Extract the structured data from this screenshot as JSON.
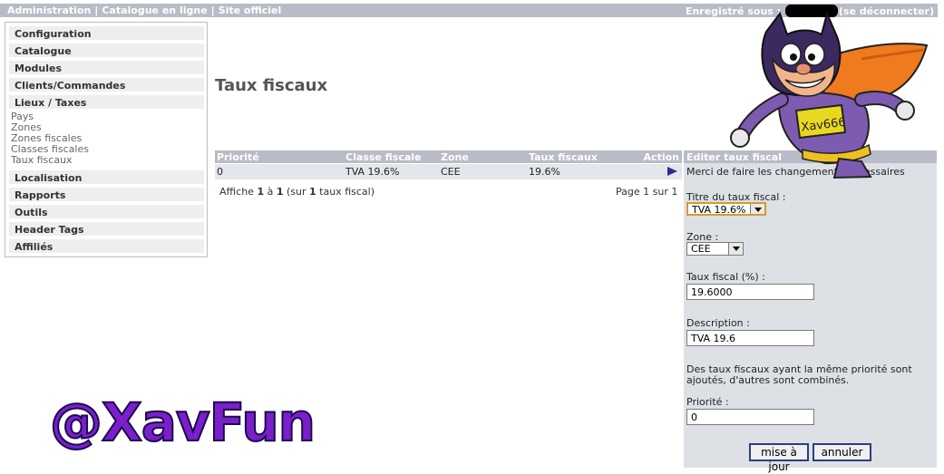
{
  "topbar": {
    "links": [
      "Administration",
      "Catalogue en ligne",
      "Site officiel"
    ],
    "separator": "|",
    "registered_prefix": "Enregistré sous :",
    "logout": "(se déconnecter)"
  },
  "nav": {
    "items_top": [
      "Configuration",
      "Catalogue",
      "Modules",
      "Clients/Commandes",
      "Lieux / Taxes"
    ],
    "subitems": [
      "Pays",
      "Zones",
      "Zones fiscales",
      "Classes fiscales",
      "Taux fiscaux"
    ],
    "items_bottom": [
      "Localisation",
      "Rapports",
      "Outils",
      "Header Tags",
      "Affiliés"
    ]
  },
  "page": {
    "title": "Taux fiscaux"
  },
  "table": {
    "headers": [
      "Priorité",
      "Classe fiscale",
      "Zone",
      "Taux fiscaux",
      "Action"
    ],
    "rows": [
      {
        "priority": "0",
        "class": "TVA 19.6%",
        "zone": "CEE",
        "rate": "19.6%"
      }
    ],
    "pager": {
      "text_1": "Affiche ",
      "from": "1",
      "text_2": " à ",
      "to": "1",
      "text_3": " (sur ",
      "total": "1",
      "text_4": " taux fiscal)",
      "page_info": "Page 1 sur 1"
    }
  },
  "edit_panel": {
    "header": "Editer taux fiscal",
    "intro": "Merci de faire les changements nécessaires",
    "title_label": "Titre du taux fiscal :",
    "title_value": "TVA 19.6%",
    "zone_label": "Zone :",
    "zone_value": "CEE",
    "rate_label": "Taux fiscal (%) :",
    "rate_value": "19.6000",
    "description_label": "Description :",
    "description_value": "TVA 19.6",
    "note": "Des taux fiscaux ayant la même priorité sont ajoutés, d'autres sont combinés.",
    "priority_label": "Priorité :",
    "priority_value": "0",
    "update_button": "mise à jour",
    "cancel_button": "annuler"
  },
  "mascot": {
    "badge": "Xav666"
  },
  "watermark": "@XavFun",
  "colors": {
    "bar": "#b9bcc6",
    "panel": "#dde1e6",
    "watermark": "#7a1fc9"
  }
}
